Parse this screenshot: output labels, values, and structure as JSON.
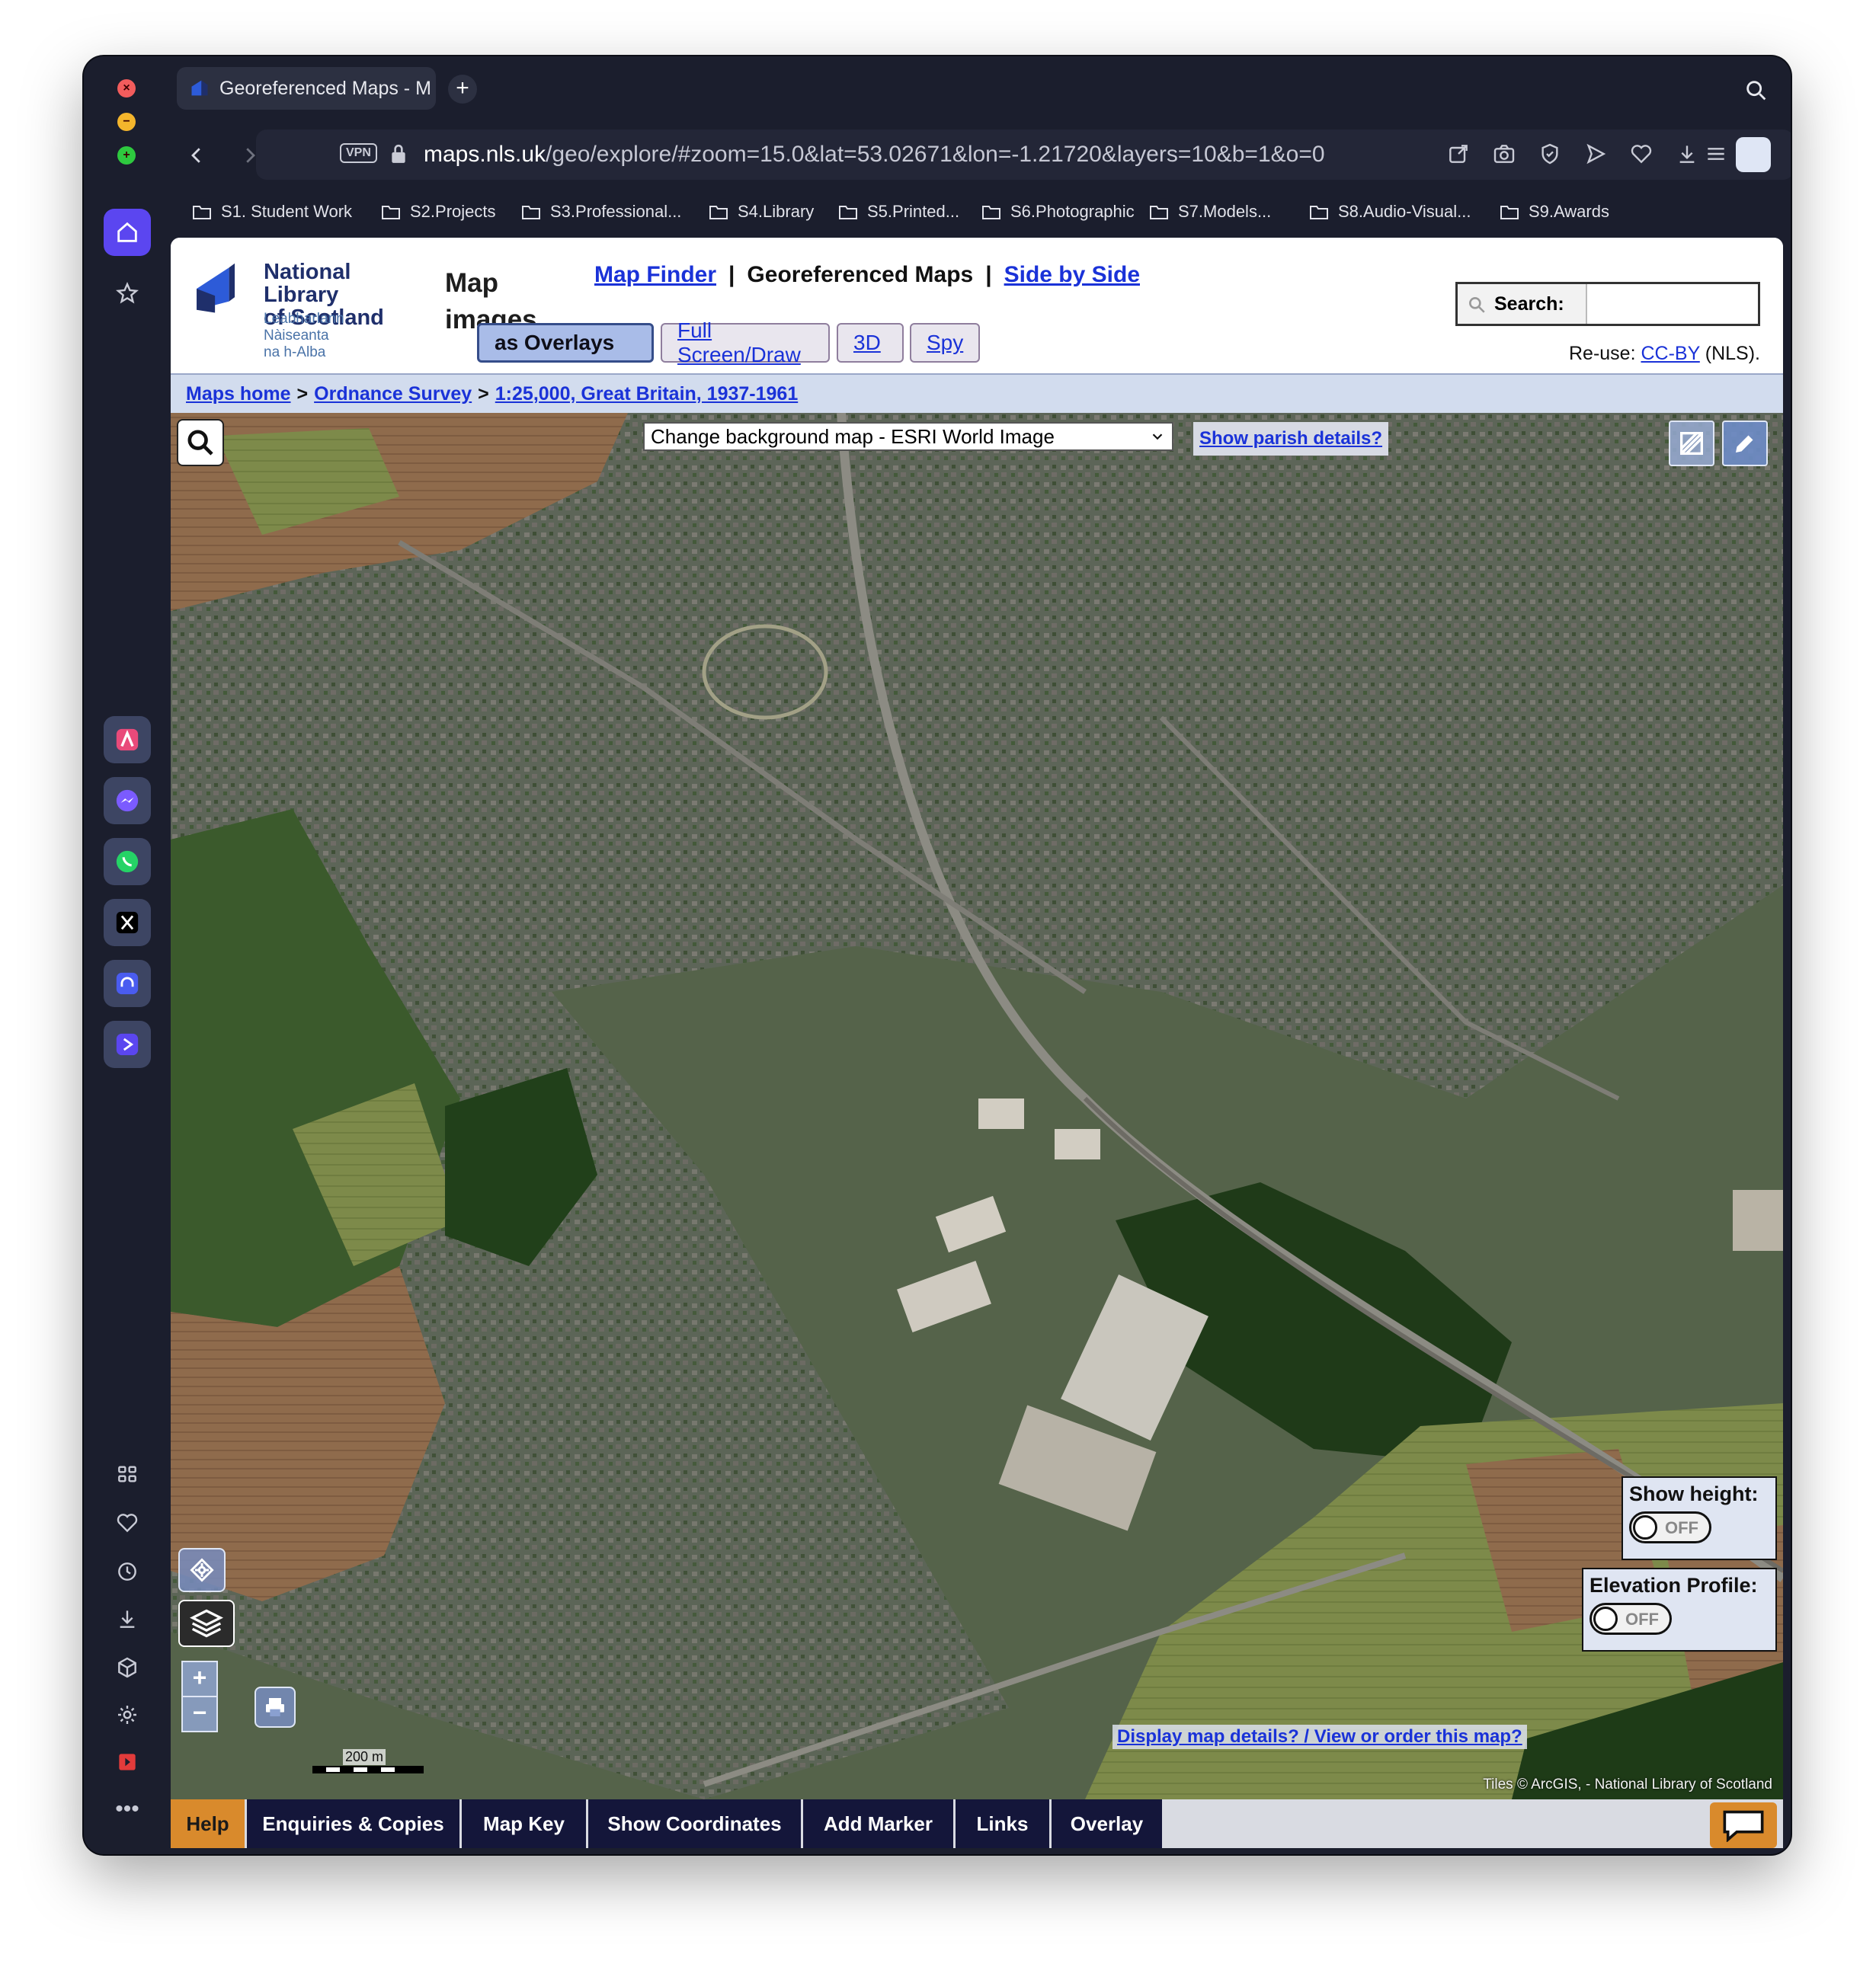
{
  "browser": {
    "tab_title": "Georeferenced Maps - M",
    "url_host": "maps.nls.uk",
    "url_path": "/geo/explore/#zoom=15.0&lat=53.02671&lon=-1.21720&layers=10&b=1&o=0",
    "vpn_label": "VPN",
    "bookmarks": [
      "S1. Student Work",
      "S2.Projects",
      "S3.Professional...",
      "S4.Library",
      "S5.Printed...",
      "S6.Photographic",
      "S7.Models...",
      "S8.Audio-Visual...",
      "S9.Awards"
    ]
  },
  "header": {
    "logo_line1": "National Library",
    "logo_line2": "of Scotland",
    "logo_gaelic1": "Leabharlann Nàiseanta",
    "logo_gaelic2": "na h-Alba",
    "section_line1": "Map",
    "section_line2": "images",
    "nav_map_finder": "Map Finder",
    "nav_current": "Georeferenced Maps",
    "nav_side_by_side": "Side by Side",
    "mode_overlays": "as Overlays",
    "mode_fullscreen": "Full Screen/Draw",
    "mode_3d": "3D",
    "mode_spy": "Spy",
    "search_label": "Search:",
    "search_value": "",
    "reuse_prefix": "Re-use: ",
    "reuse_link": "CC-BY",
    "reuse_suffix": " (NLS)."
  },
  "breadcrumb": {
    "home": "Maps home",
    "series": "Ordnance Survey",
    "map": "1:25,000, Great Britain, 1937-1961",
    "separator": ">"
  },
  "map": {
    "background_select": "Change background map - ESRI World Image",
    "parish_link": "Show parish details?",
    "show_height_title": "Show height:",
    "show_height_state": "OFF",
    "elevation_title": "Elevation Profile:",
    "elevation_state": "OFF",
    "details_link": "Display map details? / View or order this map?",
    "attribution": "Tiles © ArcGIS, - National Library of Scotland",
    "scale_label": "200 m",
    "zoom_in": "+",
    "zoom_out": "−"
  },
  "bottom_tabs": [
    "Help",
    "Enquiries & Copies",
    "Map Key",
    "Show Coordinates",
    "Add Marker",
    "Links",
    "Overlay"
  ]
}
